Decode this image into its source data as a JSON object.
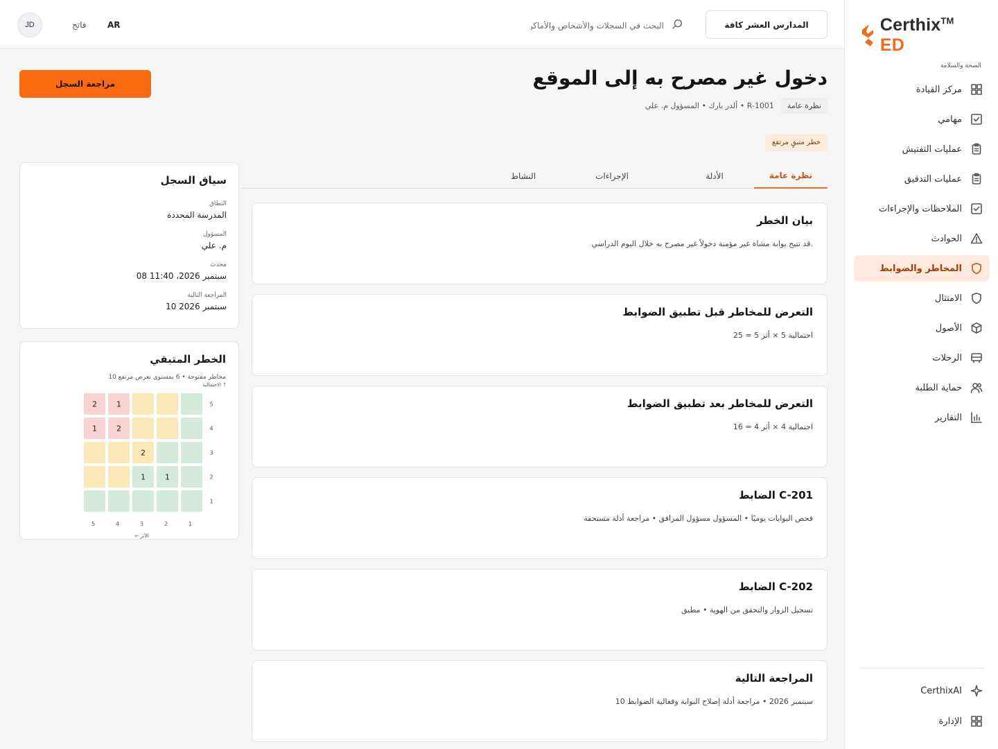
{
  "brand": {
    "name": "Certhix",
    "tm": "TM",
    "suffix": "ED",
    "tagline": "الصحة والسلامة"
  },
  "sidebar": {
    "items": [
      {
        "label": "مركز القيادة",
        "icon": "grid-icon"
      },
      {
        "label": "مهامي",
        "icon": "checkbox-icon"
      },
      {
        "label": "عمليات التفتيش",
        "icon": "clipboard-icon"
      },
      {
        "label": "عمليات التدقيق",
        "icon": "clipboard-icon"
      },
      {
        "label": "الملاحظات والإجراءات",
        "icon": "checkbox-icon"
      },
      {
        "label": "الحوادث",
        "icon": "warning-icon"
      },
      {
        "label": "المخاطر والضوابط",
        "icon": "shield-icon",
        "active": true
      },
      {
        "label": "الامتثال",
        "icon": "shield-icon"
      },
      {
        "label": "الأصول",
        "icon": "box-icon"
      },
      {
        "label": "الرحلات",
        "icon": "bus-icon"
      },
      {
        "label": "حماية الطلبة",
        "icon": "users-icon"
      },
      {
        "label": "التقارير",
        "icon": "bar-chart-icon"
      }
    ],
    "bottom": [
      {
        "label": "CerthixAI",
        "icon": "sparkle-icon"
      },
      {
        "label": "الإدارة",
        "icon": "grid-icon"
      }
    ]
  },
  "topbar": {
    "school_button": "المدارس العشر كافة",
    "search_placeholder": "البحث في السجلات والأشخاص والأماكن",
    "lang_active": "AR",
    "theme_label": "فاتح",
    "avatar_initials": "JD"
  },
  "header": {
    "title": "دخول غير مصرح به إلى الموقع",
    "chip": "نظرة عامة",
    "meta": "ألدر بارك • المسؤول م. علي • R-1001",
    "risk_badge": "خطر متبقٍ مرتفع",
    "review_button": "مراجعة السجل"
  },
  "tabs": [
    "نظرة عامة",
    "الأدلة",
    "الإجراءات",
    "النشاط"
  ],
  "cards": [
    {
      "title": "بيان الخطر",
      "body": "قد تتيح بوابة مشاة غير مؤمنة دخولاً غير مصرح به خلال اليوم الدراسي."
    },
    {
      "title": "التعرض للمخاطر قبل تطبيق الضوابط",
      "body": "احتمالية 5 × أثر 5 = 25"
    },
    {
      "title": "التعرض للمخاطر بعد تطبيق الضوابط",
      "body": "احتمالية 4 × أثر 4 = 16"
    },
    {
      "title": "الضابط C-201",
      "body": "فحص البوابات يوميًا • المسؤول مسؤول المرافق • مراجعة أدلة مستحقة"
    },
    {
      "title": "الضابط C-202",
      "body": "تسجيل الزوار والتحقق من الهوية • مطبق"
    },
    {
      "title": "المراجعة التالية",
      "body": "10 سبتمبر 2026 • مراجعة أدلة إصلاح البوابة وفعالية الضوابط"
    }
  ],
  "context": {
    "title": "سياق السجل",
    "fields": [
      {
        "label": "النطاق",
        "value": "المدرسة المحددة"
      },
      {
        "label": "المسؤول",
        "value": "م. علي"
      },
      {
        "label": "محدث",
        "value": "08 سبتمبر 2026، 11:40"
      },
      {
        "label": "المراجعة التالية",
        "value": "10 سبتمبر 2026"
      }
    ]
  },
  "residual": {
    "title": "الخطر المتبقي",
    "subtitle": "10 مخاطر مفتوحة • 6 بمستوى تعرض مرتفع",
    "y_label": "الاحتمالية ↑",
    "x_label": "الأثر ←"
  },
  "chart_data": {
    "type": "heatmap",
    "title": "الخطر المتبقي",
    "xlabel": "الأثر ←",
    "ylabel": "الاحتمالية ↑",
    "x_ticks": [
      5,
      4,
      3,
      2,
      1
    ],
    "y_ticks": [
      5,
      4,
      3,
      2,
      1
    ],
    "cells": [
      {
        "likelihood": 5,
        "impact": 5,
        "count": 2,
        "level": "high"
      },
      {
        "likelihood": 5,
        "impact": 4,
        "count": 1,
        "level": "high"
      },
      {
        "likelihood": 5,
        "impact": 3,
        "count": null,
        "level": "medium"
      },
      {
        "likelihood": 5,
        "impact": 2,
        "count": null,
        "level": "medium"
      },
      {
        "likelihood": 5,
        "impact": 1,
        "count": null,
        "level": "low"
      },
      {
        "likelihood": 4,
        "impact": 5,
        "count": 1,
        "level": "high"
      },
      {
        "likelihood": 4,
        "impact": 4,
        "count": 2,
        "level": "high"
      },
      {
        "likelihood": 4,
        "impact": 3,
        "count": null,
        "level": "medium"
      },
      {
        "likelihood": 4,
        "impact": 2,
        "count": null,
        "level": "medium"
      },
      {
        "likelihood": 4,
        "impact": 1,
        "count": null,
        "level": "low"
      },
      {
        "likelihood": 3,
        "impact": 5,
        "count": null,
        "level": "medium"
      },
      {
        "likelihood": 3,
        "impact": 4,
        "count": null,
        "level": "medium"
      },
      {
        "likelihood": 3,
        "impact": 3,
        "count": 2,
        "level": "medium"
      },
      {
        "likelihood": 3,
        "impact": 2,
        "count": null,
        "level": "low"
      },
      {
        "likelihood": 3,
        "impact": 1,
        "count": null,
        "level": "low"
      },
      {
        "likelihood": 2,
        "impact": 5,
        "count": null,
        "level": "medium"
      },
      {
        "likelihood": 2,
        "impact": 4,
        "count": null,
        "level": "medium"
      },
      {
        "likelihood": 2,
        "impact": 3,
        "count": 1,
        "level": "low"
      },
      {
        "likelihood": 2,
        "impact": 2,
        "count": 1,
        "level": "low"
      },
      {
        "likelihood": 2,
        "impact": 1,
        "count": null,
        "level": "low"
      },
      {
        "likelihood": 1,
        "impact": 5,
        "count": null,
        "level": "low"
      },
      {
        "likelihood": 1,
        "impact": 4,
        "count": null,
        "level": "low"
      },
      {
        "likelihood": 1,
        "impact": 3,
        "count": null,
        "level": "low"
      },
      {
        "likelihood": 1,
        "impact": 2,
        "count": null,
        "level": "low"
      },
      {
        "likelihood": 1,
        "impact": 1,
        "count": null,
        "level": "low"
      }
    ],
    "level_colors": {
      "high": "#f8d3d3",
      "medium": "#fce8b6",
      "low": "#d4eadb"
    }
  },
  "colors": {
    "accent": "#f26a1b",
    "accent_button": "#fa6a0f",
    "active_nav_bg": "#fde9de"
  }
}
